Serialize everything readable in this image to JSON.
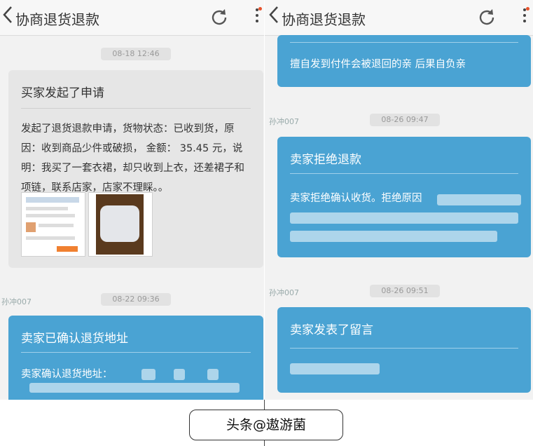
{
  "left": {
    "title": "协商退货退款",
    "timestamp1": "08-18 12:46",
    "card1": {
      "title": "买家发起了申请",
      "body": "发起了退货退款申请，货物状态：已收到货，原因：收到商品少件或破损， 金额： 35.45 元，说明：我买了一套衣裙，却只收到上衣，还差裙子和项链，联系店家，店家不理睬。。"
    },
    "sender2": "孙冲007",
    "timestamp2": "08-22 09:36",
    "card2": {
      "title": "卖家已确认退货地址",
      "body": "卖家确认退货地址："
    }
  },
  "right": {
    "title": "协商退货退款",
    "card0": {
      "body": "擅自发到付件会被退回的亲 后果自负亲"
    },
    "sender1": "孙冲007",
    "timestamp1": "08-26 09:47",
    "card1": {
      "title": "卖家拒绝退款",
      "body": "卖家拒绝确认收货。拒绝原因"
    },
    "sender2": "孙冲007",
    "timestamp2": "08-26 09:51",
    "card2": {
      "title": "卖家发表了留言"
    }
  },
  "watermark": "头条@遨游菌",
  "colors": {
    "accent_blue": "#4aa3d3",
    "card_grey": "#e6e6e6",
    "background": "#f2f2f2"
  },
  "icons": [
    "chevron-left-icon",
    "refresh-icon",
    "more-vertical-icon"
  ]
}
